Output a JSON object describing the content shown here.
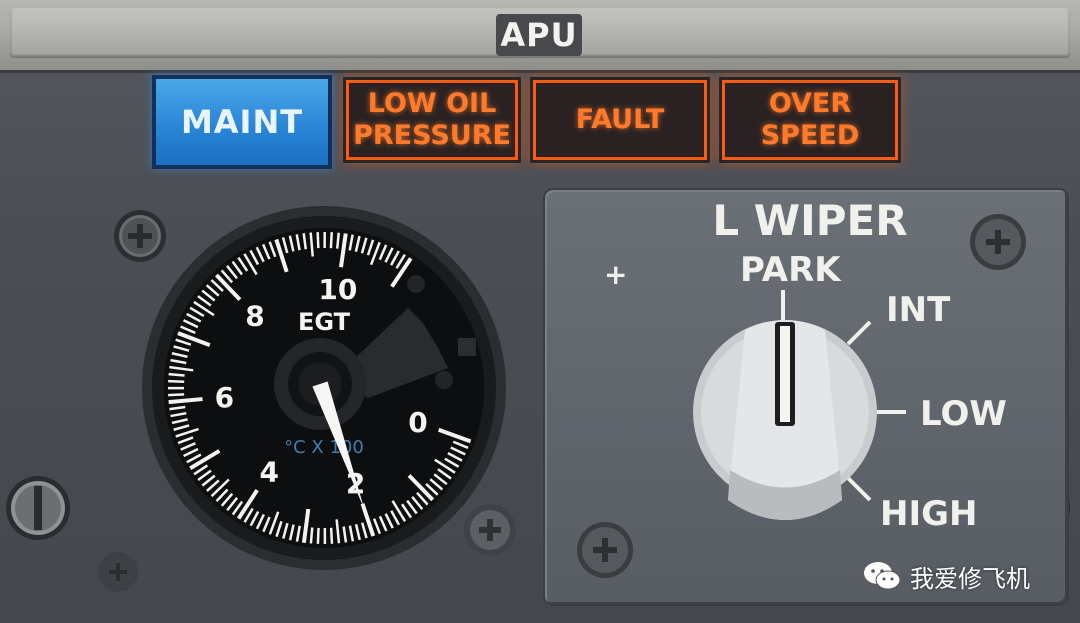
{
  "header": {
    "title": "APU"
  },
  "annunciators": [
    {
      "id": "maint",
      "lines": [
        "MAINT"
      ],
      "color": "#2b86d6"
    },
    {
      "id": "low-oil-pressure",
      "lines": [
        "LOW OIL",
        "PRESSURE"
      ],
      "color": "#ff7a2a"
    },
    {
      "id": "fault",
      "lines": [
        "FAULT"
      ],
      "color": "#ff7a2a"
    },
    {
      "id": "over-speed",
      "lines": [
        "OVER",
        "SPEED"
      ],
      "color": "#ff7a2a"
    }
  ],
  "egt_gauge": {
    "label": "EGT",
    "unit": "°C X 100",
    "scale_labels": [
      "0",
      "2",
      "4",
      "6",
      "8",
      "10"
    ],
    "needle_value": 2
  },
  "wiper": {
    "title": "L WIPER",
    "positions": [
      "PARK",
      "INT",
      "LOW",
      "HIGH"
    ],
    "selected": "PARK",
    "plus_symbol": "+"
  },
  "watermark": {
    "text": "我爱修飞机",
    "icon": "wechat-icon"
  },
  "colors": {
    "amber": "#ff7a2a",
    "blue": "#2b86d6",
    "panel": "#4a4e54"
  }
}
